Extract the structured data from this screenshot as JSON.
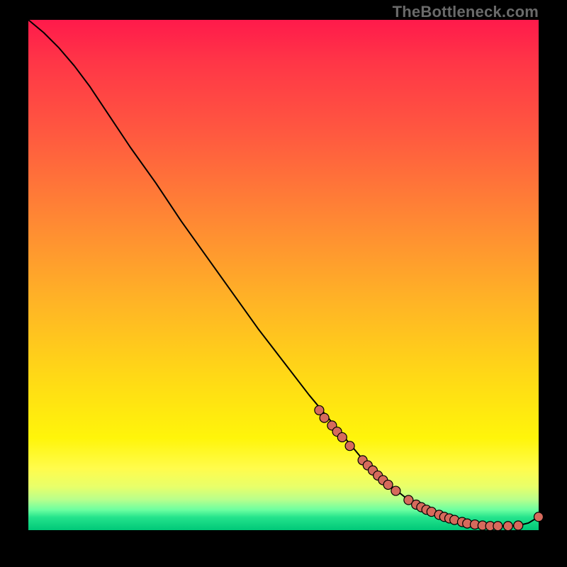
{
  "watermark": "TheBottleneck.com",
  "chart_data": {
    "type": "line",
    "title": "",
    "xlabel": "",
    "ylabel": "",
    "xlim": [
      0,
      100
    ],
    "ylim": [
      0,
      100
    ],
    "series": [
      {
        "name": "curve",
        "x": [
          0,
          3,
          6,
          9,
          12,
          16,
          20,
          25,
          30,
          35,
          40,
          45,
          50,
          55,
          60,
          65,
          70,
          75,
          80,
          83,
          86,
          88,
          90,
          92,
          94,
          96,
          98,
          100
        ],
        "y": [
          100,
          97.5,
          94.5,
          91,
          87,
          81,
          75,
          68,
          60.5,
          53.5,
          46.5,
          39.5,
          33,
          26.5,
          20.5,
          14.5,
          9.5,
          5.5,
          2.8,
          1.6,
          1.0,
          0.8,
          0.8,
          0.8,
          0.8,
          0.9,
          1.4,
          2.6
        ]
      }
    ],
    "markers": {
      "name": "dots",
      "x": [
        57,
        58,
        59.5,
        60.5,
        61.5,
        63,
        65.5,
        66.5,
        67.5,
        68.5,
        69.5,
        70.5,
        72,
        74.5,
        76,
        77,
        78,
        79,
        80.5,
        81.5,
        82.5,
        83.5,
        85,
        86,
        87.5,
        89,
        90.5,
        92,
        94,
        96,
        100
      ],
      "y": [
        23.5,
        22.0,
        20.5,
        19.3,
        18.2,
        16.5,
        13.7,
        12.7,
        11.7,
        10.7,
        9.8,
        8.9,
        7.7,
        5.9,
        5.0,
        4.5,
        4.0,
        3.6,
        3.0,
        2.6,
        2.3,
        2.0,
        1.6,
        1.3,
        1.1,
        0.9,
        0.8,
        0.8,
        0.8,
        0.9,
        2.6
      ]
    }
  }
}
